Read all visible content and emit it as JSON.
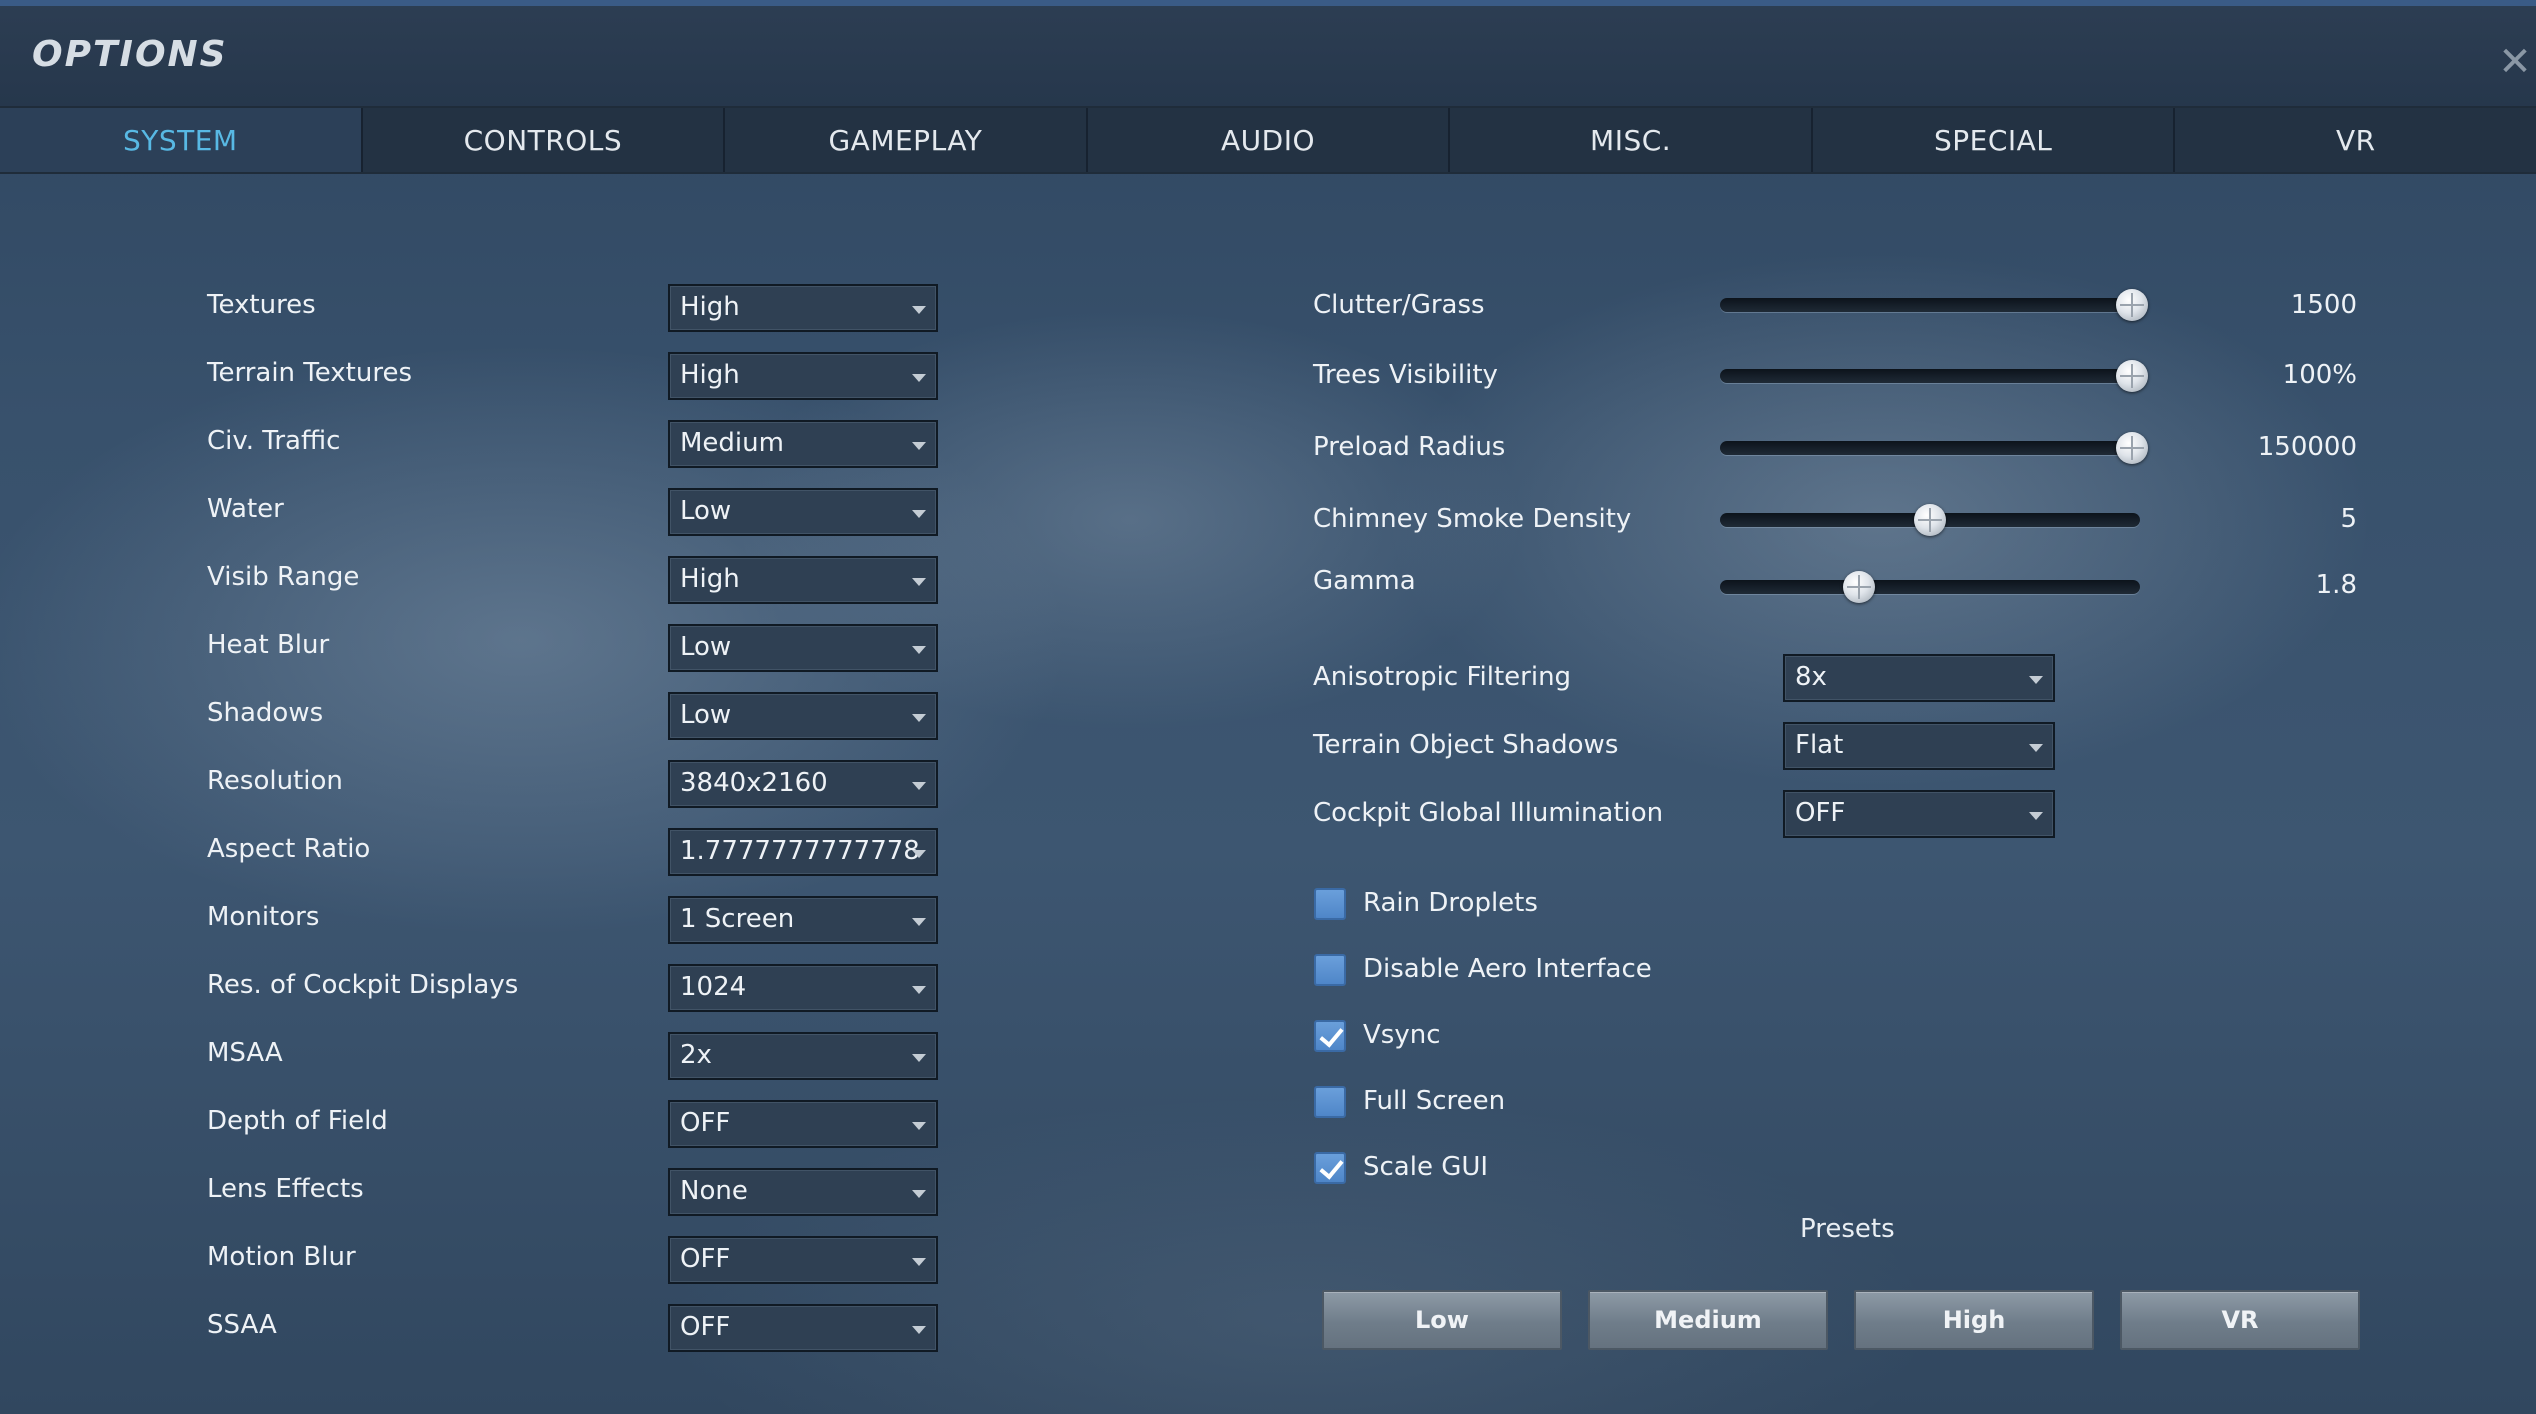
{
  "window": {
    "title": "OPTIONS",
    "close_glyph": "✕"
  },
  "tabs": [
    {
      "label": "SYSTEM",
      "active": true
    },
    {
      "label": "CONTROLS"
    },
    {
      "label": "GAMEPLAY"
    },
    {
      "label": "AUDIO"
    },
    {
      "label": "MISC."
    },
    {
      "label": "SPECIAL"
    },
    {
      "label": "VR"
    }
  ],
  "left_settings": [
    {
      "label": "Textures",
      "value": "High"
    },
    {
      "label": "Terrain Textures",
      "value": "High"
    },
    {
      "label": "Civ. Traffic",
      "value": "Medium"
    },
    {
      "label": "Water",
      "value": "Low"
    },
    {
      "label": "Visib Range",
      "value": "High"
    },
    {
      "label": "Heat Blur",
      "value": "Low"
    },
    {
      "label": "Shadows",
      "value": "Low"
    },
    {
      "label": "Resolution",
      "value": "3840x2160"
    },
    {
      "label": "Aspect Ratio",
      "value": "1.7777777777778"
    },
    {
      "label": "Monitors",
      "value": "1 Screen"
    },
    {
      "label": "Res. of Cockpit Displays",
      "value": "1024"
    },
    {
      "label": "MSAA",
      "value": "2x"
    },
    {
      "label": "Depth of Field",
      "value": "OFF"
    },
    {
      "label": "Lens Effects",
      "value": "None"
    },
    {
      "label": "Motion Blur",
      "value": "OFF"
    },
    {
      "label": "SSAA",
      "value": "OFF"
    }
  ],
  "sliders": [
    {
      "label": "Clutter/Grass",
      "value": "1500",
      "fraction": 1.0
    },
    {
      "label": "Trees Visibility",
      "value": "100%",
      "fraction": 1.0
    },
    {
      "label": "Preload Radius",
      "value": "150000",
      "fraction": 1.0
    },
    {
      "label": "Chimney Smoke Density",
      "value": "5",
      "fraction": 0.5
    },
    {
      "label": "Gamma",
      "value": "1.8",
      "fraction": 0.33
    }
  ],
  "right_dropdowns": [
    {
      "label": "Anisotropic Filtering",
      "value": "8x"
    },
    {
      "label": "Terrain Object Shadows",
      "value": "Flat"
    },
    {
      "label": "Cockpit Global Illumination",
      "value": "OFF"
    }
  ],
  "checkboxes": [
    {
      "label": "Rain Droplets",
      "checked": false
    },
    {
      "label": "Disable Aero Interface",
      "checked": false
    },
    {
      "label": "Vsync",
      "checked": true
    },
    {
      "label": "Full Screen",
      "checked": false
    },
    {
      "label": "Scale GUI",
      "checked": true
    }
  ],
  "presets": {
    "label": "Presets",
    "buttons": [
      "Low",
      "Medium",
      "High",
      "VR"
    ]
  },
  "colors": {
    "active_tab_text": "#58b9e4",
    "checkbox_fill": "#5b92d2",
    "background": "#3d5671"
  }
}
